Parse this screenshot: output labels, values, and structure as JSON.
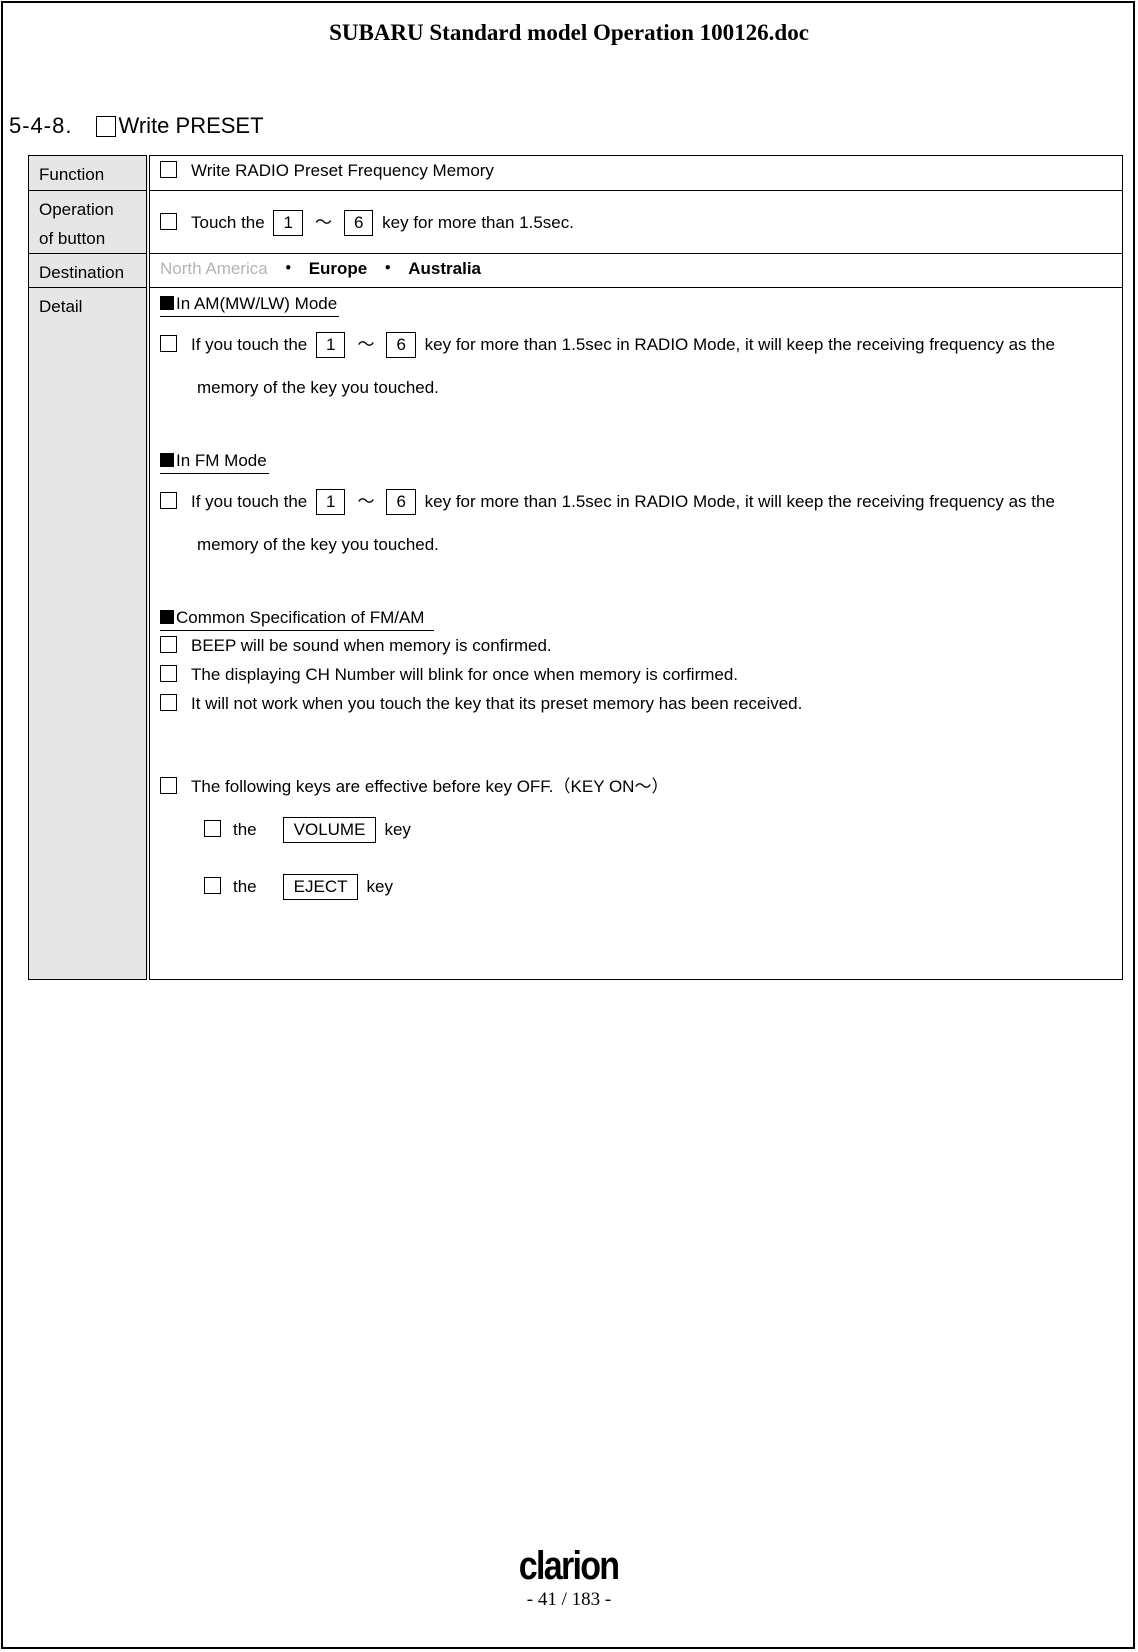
{
  "header": {
    "title": "SUBARU Standard model Operation 100126.doc"
  },
  "section": {
    "number": "5-4-8.",
    "title": "Write PRESET"
  },
  "table": {
    "function": {
      "label": "Function",
      "text": "Write RADIO Preset Frequency Memory"
    },
    "operation": {
      "label_line1": "Operation",
      "label_line2": "of button",
      "prefix": "Touch the",
      "key_from": "1",
      "tilde": "～",
      "key_to": "6",
      "suffix": "key for more than 1.5sec."
    },
    "destination": {
      "label": "Destination",
      "items": [
        {
          "name": "North America",
          "active": false
        },
        {
          "name": "Europe",
          "active": true
        },
        {
          "name": "Australia",
          "active": true
        }
      ],
      "separator": "・"
    },
    "detail": {
      "label": "Detail",
      "am": {
        "heading": "In AM(MW/LW)  Mode",
        "prefix": "If you touch the",
        "key_from": "1",
        "tilde": "～",
        "key_to": "6",
        "suffix": "key for more than 1.5sec in RADIO Mode, it will keep the receiving frequency as the",
        "continuation": "memory of the key you touched."
      },
      "fm": {
        "heading": "In FM Mode",
        "prefix": "If you touch the",
        "key_from": "1",
        "tilde": "～",
        "key_to": "6",
        "suffix": "key for more than 1.5sec in RADIO Mode, it will keep the receiving frequency as the",
        "continuation": "memory of the key you touched."
      },
      "common": {
        "heading": "Common Specification of FM/AM",
        "items": [
          "BEEP will be sound when memory is confirmed.",
          "The displaying CH Number will blink for once when memory is corfirmed.",
          "It will not work when you touch the key that its preset memory has been received."
        ]
      },
      "effective": {
        "text": "The following keys are effective before key OFF.（KEY ON～）",
        "keys": [
          {
            "prefix": "the",
            "key": "VOLUME",
            "suffix": "key"
          },
          {
            "prefix": "the",
            "key": "EJECT",
            "suffix": "key"
          }
        ]
      }
    }
  },
  "footer": {
    "logo": "clarion",
    "page": "- 41 / 183 -"
  }
}
